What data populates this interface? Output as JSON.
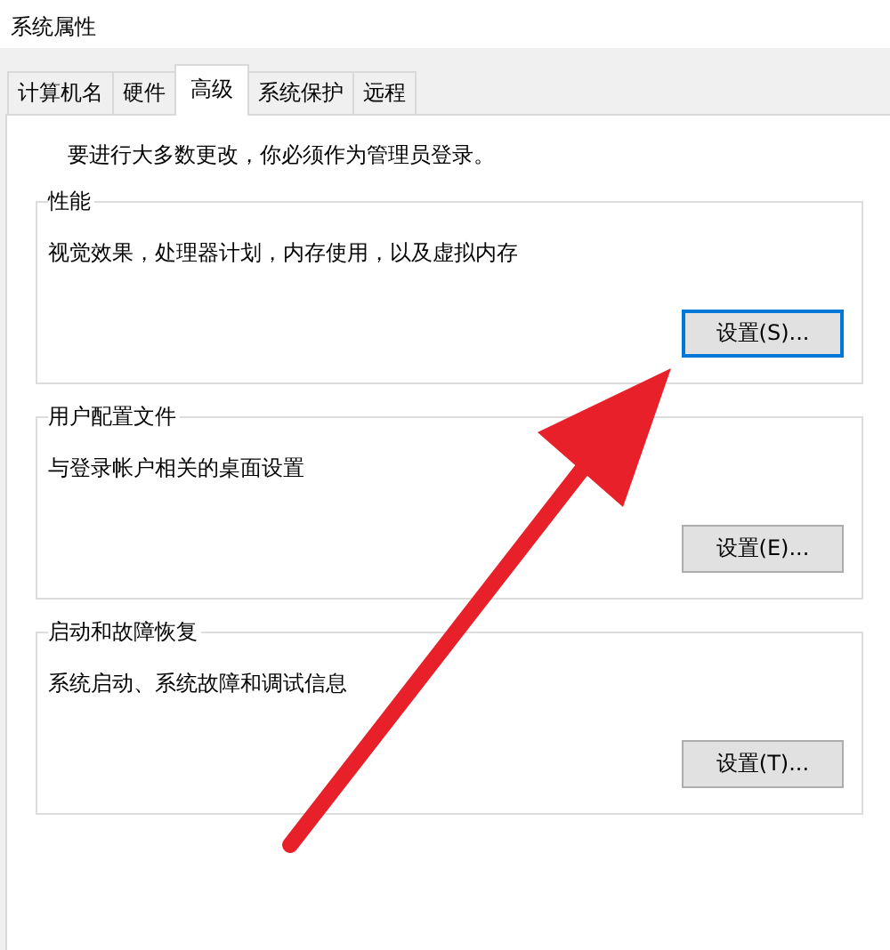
{
  "window": {
    "title": "系统属性"
  },
  "tabs": [
    {
      "label": "计算机名",
      "selected": false
    },
    {
      "label": "硬件",
      "selected": false
    },
    {
      "label": "高级",
      "selected": true
    },
    {
      "label": "系统保护",
      "selected": false
    },
    {
      "label": "远程",
      "selected": false
    }
  ],
  "notice": "要进行大多数更改，你必须作为管理员登录。",
  "groups": [
    {
      "title": "性能",
      "description": "视觉效果，处理器计划，内存使用，以及虚拟内存",
      "button": {
        "label": "设置(S)...",
        "focused": true
      }
    },
    {
      "title": "用户配置文件",
      "description": "与登录帐户相关的桌面设置",
      "button": {
        "label": "设置(E)...",
        "focused": false
      }
    },
    {
      "title": "启动和故障恢复",
      "description": "系统启动、系统故障和调试信息",
      "button": {
        "label": "设置(T)...",
        "focused": false
      }
    }
  ],
  "annotation": {
    "kind": "arrow"
  }
}
